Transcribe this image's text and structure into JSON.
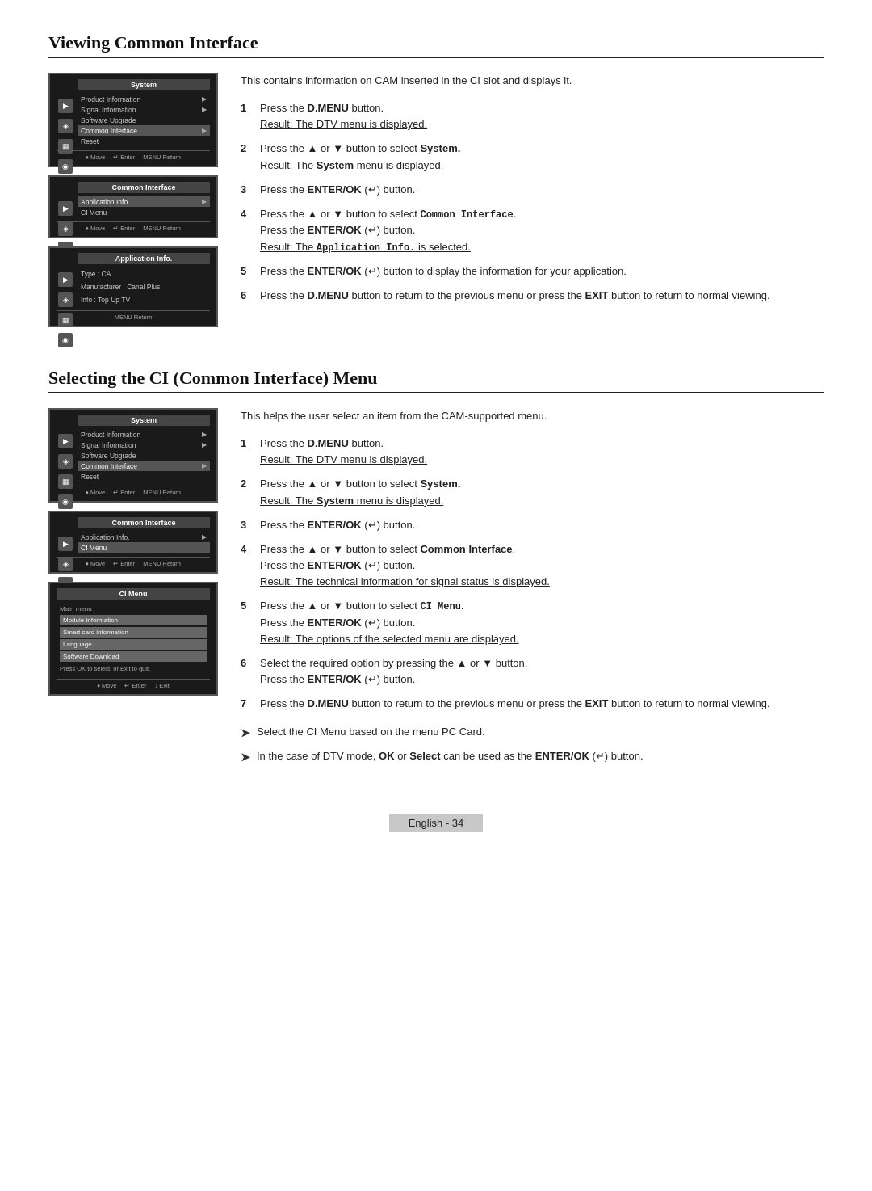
{
  "section1": {
    "title": "Viewing Common Interface",
    "intro": "This contains information on CAM inserted in the CI slot and displays it.",
    "steps": [
      {
        "num": "1",
        "text": "Press the <b>D.MENU</b> button.",
        "result": "Result: The DTV menu is displayed."
      },
      {
        "num": "2",
        "text": "Press the ▲ or ▼ button to select <b>System.</b>",
        "result": "Result: The <b>System</b> menu is displayed."
      },
      {
        "num": "3",
        "text": "Press the <b>ENTER/OK</b> (↵) button."
      },
      {
        "num": "4",
        "text": "Press the ▲ or ▼ button to select <code>Common Interface</code>.",
        "extra": "Press the <b>ENTER/OK</b> (↵) button.",
        "result": "Result: The <code>Application Info.</code> is selected."
      },
      {
        "num": "5",
        "text": "Press the <b>ENTER/OK</b> (↵) button to display the information for your application."
      },
      {
        "num": "6",
        "text": "Press the <b>D.MENU</b> button to return to the previous menu or press the <b>EXIT</b> button to return to normal viewing."
      }
    ],
    "screens": [
      {
        "id": "s1-screen1",
        "title": "System",
        "items": [
          {
            "label": "Product Information",
            "arrow": true,
            "highlighted": false
          },
          {
            "label": "Signal Information",
            "arrow": true,
            "highlighted": false
          },
          {
            "label": "Software Upgrade",
            "arrow": false,
            "highlighted": false
          },
          {
            "label": "Common Interface",
            "arrow": true,
            "highlighted": true
          },
          {
            "label": "Reset",
            "arrow": false,
            "highlighted": false
          }
        ],
        "bottomBar": [
          "♦ Move",
          "↵ Enter",
          "MENU Return"
        ]
      },
      {
        "id": "s1-screen2",
        "title": "Common Interface",
        "items": [
          {
            "label": "Application Info.",
            "arrow": true,
            "highlighted": true
          },
          {
            "label": "CI Menu",
            "arrow": false,
            "highlighted": false
          }
        ],
        "bottomBar": [
          "♦ Move",
          "↵ Enter",
          "MENU Return"
        ]
      },
      {
        "id": "s1-screen3",
        "title": "Application Info.",
        "appInfo": [
          "Type : CA",
          "Manufacturer : Canal Plus",
          "Info : Top Up TV"
        ],
        "bottomBar": [
          "MENU Return"
        ]
      }
    ]
  },
  "section2": {
    "title": "Selecting the CI (Common Interface) Menu",
    "intro": "This helps the user select an item from the CAM-supported menu.",
    "steps": [
      {
        "num": "1",
        "text": "Press the <b>D.MENU</b> button.",
        "result": "Result: The DTV menu is displayed."
      },
      {
        "num": "2",
        "text": "Press the ▲ or ▼ button to select <b>System.</b>",
        "result": "Result: The <b>System</b> menu is displayed."
      },
      {
        "num": "3",
        "text": "Press the <b>ENTER/OK</b> (↵) button."
      },
      {
        "num": "4",
        "text": "Press the ▲ or ▼ button to select <b>Common Interface</b>.",
        "extra": "Press the <b>ENTER/OK</b> (↵) button.",
        "result": "Result: The technical information for signal status is displayed."
      },
      {
        "num": "5",
        "text": "Press the ▲ or ▼ button to select <code>CI Menu</code>.",
        "extra": "Press the <b>ENTER/OK</b> (↵) button.",
        "result": "Result: The options of the selected menu are displayed."
      },
      {
        "num": "6",
        "text": "Select the required option by pressing the ▲ or ▼ button.",
        "extra": "Press the <b>ENTER/OK</b> (↵) button."
      },
      {
        "num": "7",
        "text": "Press the <b>D.MENU</b> button to return to the previous menu or press the <b>EXIT</b> button to return to normal viewing."
      }
    ],
    "notes": [
      "Select the CI Menu based on the menu PC Card.",
      "In the case of DTV mode, <b>OK</b> or <b>Select</b> can be used as the <b>ENTER/OK</b> (↵) button."
    ],
    "screens": [
      {
        "id": "s2-screen1",
        "title": "System",
        "items": [
          {
            "label": "Product Information",
            "arrow": true,
            "highlighted": false
          },
          {
            "label": "Signal Information",
            "arrow": true,
            "highlighted": false
          },
          {
            "label": "Software Upgrade",
            "arrow": false,
            "highlighted": false
          },
          {
            "label": "Common Interface",
            "arrow": true,
            "highlighted": true
          },
          {
            "label": "Reset",
            "arrow": false,
            "highlighted": false
          }
        ],
        "bottomBar": [
          "♦ Move",
          "↵ Enter",
          "MENU Return"
        ]
      },
      {
        "id": "s2-screen2",
        "title": "Common Interface",
        "items": [
          {
            "label": "Application Info.",
            "arrow": true,
            "highlighted": false
          },
          {
            "label": "CI Menu",
            "arrow": false,
            "highlighted": true
          }
        ],
        "bottomBar": [
          "♦ Move",
          "↵ Enter",
          "MENU Return"
        ]
      },
      {
        "id": "s2-screen3",
        "title": "CI Menu",
        "mainMenu": "Main menu",
        "ciItems": [
          "Module information",
          "Smart card information",
          "Language",
          "Software Download"
        ],
        "pressOk": "Press OK to select, or Exit to quit.",
        "bottomBar": [
          "♦ Move",
          "↵ Enter",
          "↓ Exit"
        ]
      }
    ]
  },
  "footer": {
    "label": "English - 34"
  }
}
